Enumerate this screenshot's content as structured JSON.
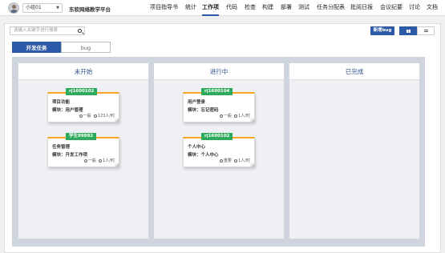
{
  "header": {
    "user": "小组01",
    "platform_title": "东软网络教学平台",
    "nav": [
      "项目指导书",
      "统计",
      "工作项",
      "代码",
      "检查",
      "构建",
      "部署",
      "测试",
      "任务分配表",
      "批阅日报",
      "会议纪要",
      "讨论",
      "文档"
    ],
    "active_nav": "工作项"
  },
  "toolbar": {
    "search_placeholder": "请输入关键字进行搜索",
    "new_bug_label": "新增bug"
  },
  "tabs": {
    "dev_tasks": "开发任务",
    "bug": "bug"
  },
  "columns": {
    "todo": "未开始",
    "doing": "进行中",
    "done": "已完成"
  },
  "cards": [
    {
      "tag": "rj1600102",
      "title": "项目功能",
      "module": "模块：用户管理",
      "priority": "一般",
      "assignee": "123人/时"
    },
    {
      "tag": "学生99992",
      "title": "任务管理",
      "module": "模块：开发工作项",
      "priority": "一般",
      "assignee": "1人/时"
    },
    {
      "tag": "rj1600104",
      "title": "用户登录",
      "module": "模块：忘记密码",
      "priority": "一般",
      "assignee": "1人/时"
    },
    {
      "tag": "rj1600102",
      "title": "个人中心",
      "module": "模块：个人中心",
      "priority": "重要",
      "assignee": "1人/时"
    }
  ],
  "colors": {
    "accent": "#2d5aa8",
    "tag_green": "#2eaa5c",
    "card_top": "#f5a623"
  }
}
